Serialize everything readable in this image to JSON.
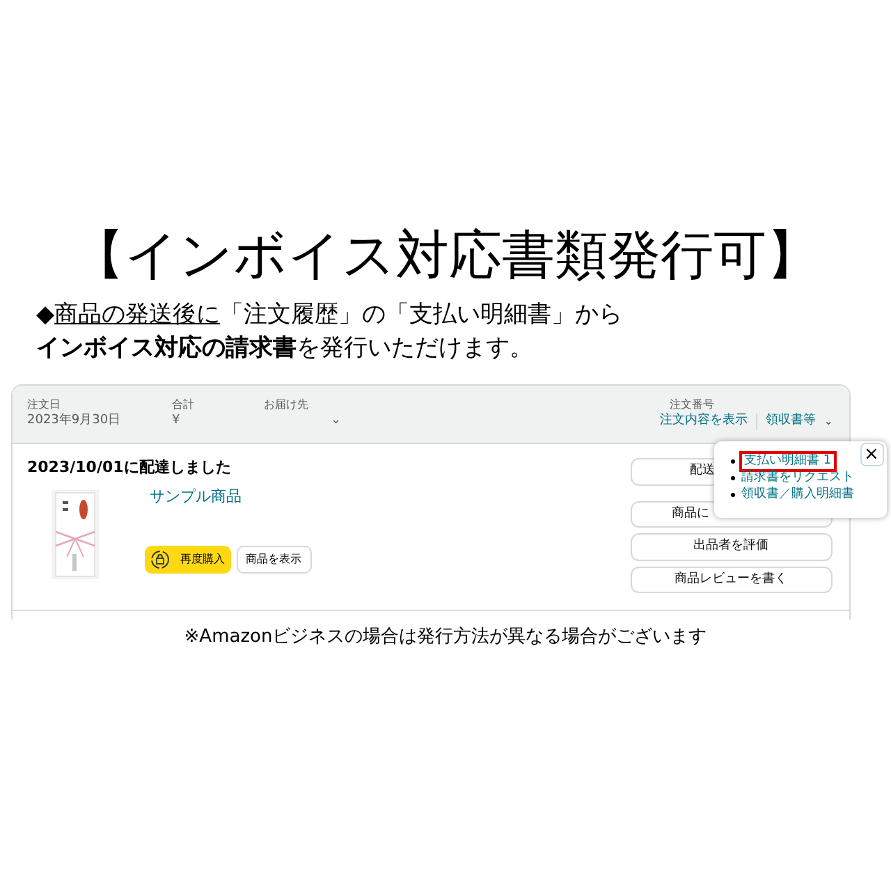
{
  "headline": "【インボイス対応書類発行可】",
  "intro": {
    "marker": "◆",
    "underlined": "商品の発送後に",
    "rest": "「注文履歴」の「支払い明細書」から"
  },
  "intro_line_2": "**インボイス対応の請求書**を発行いただけます。",
  "order": {
    "header": [
      {
        "label": "注文日",
        "value": "2023年9月30日"
      },
      {
        "label": "合計",
        "value": "¥"
      },
      {
        "label": "お届け先",
        "value": "⌄"
      }
    ],
    "order_number_label": "注文番号",
    "view_details_link": "注文内容を表示",
    "receipt_menu": "領収書等",
    "receipt_caret": "⌄",
    "delivery_status": "2023/10/01に配達しました",
    "product_name": "サンプル商品",
    "buy_again": "再度購入",
    "view_item": "商品を表示",
    "side_buttons": [
      "配送",
      "商品に",
      "出品者を評価",
      "商品レビューを書く"
    ],
    "popover": {
      "close": "×",
      "items": [
        {
          "label": "支払い明細書 1",
          "highlighted": true
        },
        {
          "label": "請求書をリクエスト",
          "highlighted": false
        },
        {
          "label": "領収書／購入明細書",
          "highlighted": false
        }
      ]
    }
  },
  "footnote": "※Amazonビジネスの場合は発行方法が異なる場合がございます"
}
